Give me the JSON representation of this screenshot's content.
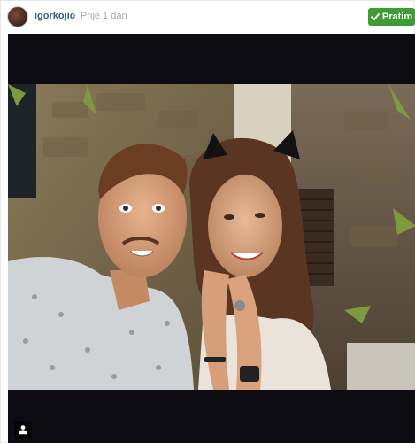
{
  "post": {
    "username": "igorkojic",
    "separator": "•",
    "time": "Prije 1 dan",
    "follow_label": "Pratim"
  },
  "icons": {
    "avatar": "profile-avatar",
    "follow_check": "checkmark-icon",
    "tag": "user-tag-icon"
  },
  "colors": {
    "username": "#3b5b80",
    "follow_button": "#3e9c35",
    "media_background": "#0d0c12"
  }
}
